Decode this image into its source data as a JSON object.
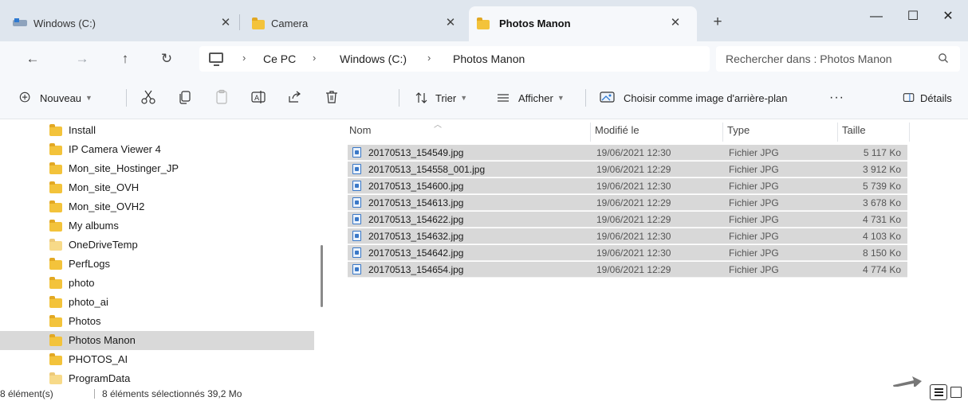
{
  "tabs": [
    {
      "label": "Windows (C:)",
      "icon": "drive-icon",
      "active": false
    },
    {
      "label": "Camera",
      "icon": "folder-icon",
      "active": false
    },
    {
      "label": "Photos Manon",
      "icon": "folder-icon",
      "active": true
    }
  ],
  "tab_close_glyph": "✕",
  "new_tab_glyph": "+",
  "window_controls": {
    "minimize": "—",
    "maximize": "☐",
    "close": "✕"
  },
  "nav": {
    "back": "←",
    "forward": "→",
    "up": "↑",
    "refresh": "↻"
  },
  "address": {
    "crumbs": [
      "Ce PC",
      "Windows (C:)",
      "Photos Manon"
    ],
    "separator": "›"
  },
  "search": {
    "placeholder": "Rechercher dans : Photos Manon"
  },
  "toolbar": {
    "new_label": "Nouveau",
    "sort_label": "Trier",
    "view_label": "Afficher",
    "wallpaper_label": "Choisir comme image d'arrière-plan",
    "more_label": "···",
    "details_label": "Détails"
  },
  "nav_pane": {
    "items": [
      "Install",
      "IP Camera Viewer 4",
      "Mon_site_Hostinger_JP",
      "Mon_site_OVH",
      "Mon_site_OVH2",
      "My albums",
      "OneDriveTemp",
      "PerfLogs",
      "photo",
      "photo_ai",
      "Photos",
      "Photos Manon",
      "PHOTOS_AI",
      "ProgramData"
    ],
    "selected": "Photos Manon"
  },
  "columns": {
    "name": "Nom",
    "modified": "Modifié le",
    "type": "Type",
    "size": "Taille"
  },
  "files": [
    {
      "name": "20170513_154549.jpg",
      "modified": "19/06/2021 12:30",
      "type": "Fichier JPG",
      "size": "5 117 Ko"
    },
    {
      "name": "20170513_154558_001.jpg",
      "modified": "19/06/2021 12:29",
      "type": "Fichier JPG",
      "size": "3 912 Ko"
    },
    {
      "name": "20170513_154600.jpg",
      "modified": "19/06/2021 12:30",
      "type": "Fichier JPG",
      "size": "5 739 Ko"
    },
    {
      "name": "20170513_154613.jpg",
      "modified": "19/06/2021 12:29",
      "type": "Fichier JPG",
      "size": "3 678 Ko"
    },
    {
      "name": "20170513_154622.jpg",
      "modified": "19/06/2021 12:29",
      "type": "Fichier JPG",
      "size": "4 731 Ko"
    },
    {
      "name": "20170513_154632.jpg",
      "modified": "19/06/2021 12:30",
      "type": "Fichier JPG",
      "size": "4 103 Ko"
    },
    {
      "name": "20170513_154642.jpg",
      "modified": "19/06/2021 12:30",
      "type": "Fichier JPG",
      "size": "8 150 Ko"
    },
    {
      "name": "20170513_154654.jpg",
      "modified": "19/06/2021 12:29",
      "type": "Fichier JPG",
      "size": "4 774 Ko"
    }
  ],
  "status": {
    "count": "8 élément(s)",
    "selection": "8 éléments sélectionnés 39,2 Mo"
  },
  "colors": {
    "accent": "#2e79d1",
    "folder": "#f3c33b",
    "selection": "#d8d8d8",
    "chrome": "#dfe6ee"
  }
}
